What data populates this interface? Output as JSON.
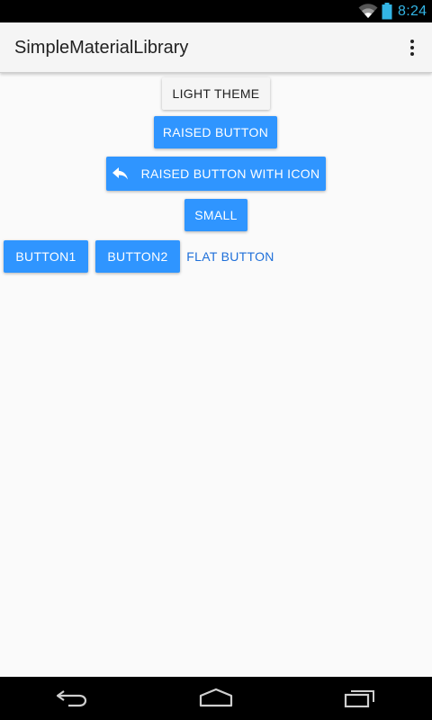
{
  "status_bar": {
    "time": "8:24",
    "icons": [
      "wifi-icon",
      "battery-icon"
    ],
    "accent_color": "#33b5e5"
  },
  "action_bar": {
    "title": "SimpleMaterialLibrary",
    "overflow_icon": "overflow-menu-icon"
  },
  "buttons": {
    "light_theme": "LIGHT THEME",
    "raised": "RAISED BUTTON",
    "raised_with_icon": "RAISED BUTTON WITH ICON",
    "raised_with_icon_icon": "reply-icon",
    "small": "SMALL",
    "button1": "BUTTON1",
    "button2": "BUTTON2",
    "flat": "FLAT BUTTON"
  },
  "colors": {
    "raised_button": "#2f95ff",
    "flat_button_text": "#1e6fd9",
    "light_button": "#f5f5f5",
    "background": "#fafafa"
  },
  "nav_bar": {
    "icons": [
      "back-icon",
      "home-icon",
      "recents-icon"
    ]
  }
}
